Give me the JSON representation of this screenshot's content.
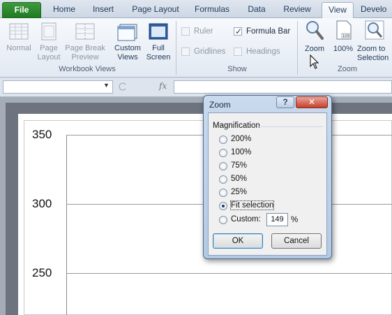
{
  "ribbon_tabs": [
    {
      "label": "File"
    },
    {
      "label": "Home"
    },
    {
      "label": "Insert"
    },
    {
      "label": "Page Layout"
    },
    {
      "label": "Formulas"
    },
    {
      "label": "Data"
    },
    {
      "label": "Review"
    },
    {
      "label": "View"
    },
    {
      "label": "Develo"
    }
  ],
  "workbook_views": {
    "group_label": "Workbook Views",
    "normal": "Normal",
    "page_layout_1": "Page",
    "page_layout_2": "Layout",
    "page_break_1": "Page Break",
    "page_break_2": "Preview",
    "custom_views_1": "Custom",
    "custom_views_2": "Views",
    "full_screen_1": "Full",
    "full_screen_2": "Screen"
  },
  "show": {
    "group_label": "Show",
    "ruler": "Ruler",
    "formula_bar": "Formula Bar",
    "gridlines": "Gridlines",
    "headings": "Headings"
  },
  "zoom_group": {
    "group_label": "Zoom",
    "zoom": "Zoom",
    "hundred": "100%",
    "zoom_to_1": "Zoom to",
    "zoom_to_2": "Selection"
  },
  "formula_bar": {
    "fx": "fx"
  },
  "chart": {
    "y_ticks": [
      "350",
      "300",
      "250"
    ]
  },
  "chart_data": {
    "type": "line",
    "ylim": [
      250,
      350
    ],
    "y_ticks": [
      350,
      300,
      250
    ],
    "grid": true
  },
  "zoom_dialog": {
    "title": "Zoom",
    "help": "?",
    "close": "✕",
    "group_label": "Magnification",
    "options": [
      {
        "label": "200%"
      },
      {
        "label": "100%"
      },
      {
        "label": "75%"
      },
      {
        "label": "50%"
      },
      {
        "label": "25%"
      },
      {
        "label": "Fit selection"
      },
      {
        "label": "Custom:"
      }
    ],
    "selected": "Fit selection",
    "custom_value": "149",
    "percent_sign": "%",
    "ok_label": "OK",
    "cancel_label": "Cancel"
  }
}
